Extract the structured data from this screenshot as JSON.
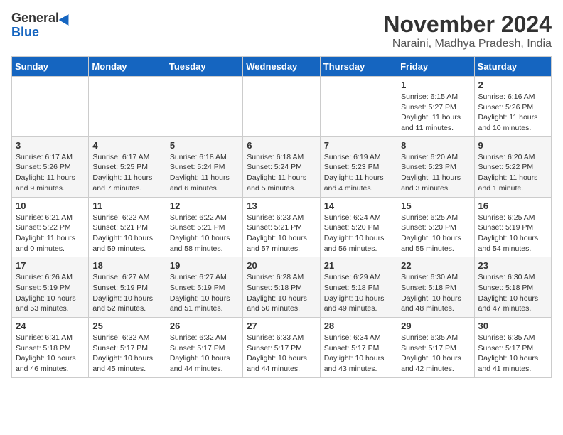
{
  "logo": {
    "line1": "General",
    "line2": "Blue"
  },
  "title": "November 2024",
  "subtitle": "Naraini, Madhya Pradesh, India",
  "days_of_week": [
    "Sunday",
    "Monday",
    "Tuesday",
    "Wednesday",
    "Thursday",
    "Friday",
    "Saturday"
  ],
  "weeks": [
    [
      {
        "day": "",
        "info": ""
      },
      {
        "day": "",
        "info": ""
      },
      {
        "day": "",
        "info": ""
      },
      {
        "day": "",
        "info": ""
      },
      {
        "day": "",
        "info": ""
      },
      {
        "day": "1",
        "info": "Sunrise: 6:15 AM\nSunset: 5:27 PM\nDaylight: 11 hours and 11 minutes."
      },
      {
        "day": "2",
        "info": "Sunrise: 6:16 AM\nSunset: 5:26 PM\nDaylight: 11 hours and 10 minutes."
      }
    ],
    [
      {
        "day": "3",
        "info": "Sunrise: 6:17 AM\nSunset: 5:26 PM\nDaylight: 11 hours and 9 minutes."
      },
      {
        "day": "4",
        "info": "Sunrise: 6:17 AM\nSunset: 5:25 PM\nDaylight: 11 hours and 7 minutes."
      },
      {
        "day": "5",
        "info": "Sunrise: 6:18 AM\nSunset: 5:24 PM\nDaylight: 11 hours and 6 minutes."
      },
      {
        "day": "6",
        "info": "Sunrise: 6:18 AM\nSunset: 5:24 PM\nDaylight: 11 hours and 5 minutes."
      },
      {
        "day": "7",
        "info": "Sunrise: 6:19 AM\nSunset: 5:23 PM\nDaylight: 11 hours and 4 minutes."
      },
      {
        "day": "8",
        "info": "Sunrise: 6:20 AM\nSunset: 5:23 PM\nDaylight: 11 hours and 3 minutes."
      },
      {
        "day": "9",
        "info": "Sunrise: 6:20 AM\nSunset: 5:22 PM\nDaylight: 11 hours and 1 minute."
      }
    ],
    [
      {
        "day": "10",
        "info": "Sunrise: 6:21 AM\nSunset: 5:22 PM\nDaylight: 11 hours and 0 minutes."
      },
      {
        "day": "11",
        "info": "Sunrise: 6:22 AM\nSunset: 5:21 PM\nDaylight: 10 hours and 59 minutes."
      },
      {
        "day": "12",
        "info": "Sunrise: 6:22 AM\nSunset: 5:21 PM\nDaylight: 10 hours and 58 minutes."
      },
      {
        "day": "13",
        "info": "Sunrise: 6:23 AM\nSunset: 5:21 PM\nDaylight: 10 hours and 57 minutes."
      },
      {
        "day": "14",
        "info": "Sunrise: 6:24 AM\nSunset: 5:20 PM\nDaylight: 10 hours and 56 minutes."
      },
      {
        "day": "15",
        "info": "Sunrise: 6:25 AM\nSunset: 5:20 PM\nDaylight: 10 hours and 55 minutes."
      },
      {
        "day": "16",
        "info": "Sunrise: 6:25 AM\nSunset: 5:19 PM\nDaylight: 10 hours and 54 minutes."
      }
    ],
    [
      {
        "day": "17",
        "info": "Sunrise: 6:26 AM\nSunset: 5:19 PM\nDaylight: 10 hours and 53 minutes."
      },
      {
        "day": "18",
        "info": "Sunrise: 6:27 AM\nSunset: 5:19 PM\nDaylight: 10 hours and 52 minutes."
      },
      {
        "day": "19",
        "info": "Sunrise: 6:27 AM\nSunset: 5:19 PM\nDaylight: 10 hours and 51 minutes."
      },
      {
        "day": "20",
        "info": "Sunrise: 6:28 AM\nSunset: 5:18 PM\nDaylight: 10 hours and 50 minutes."
      },
      {
        "day": "21",
        "info": "Sunrise: 6:29 AM\nSunset: 5:18 PM\nDaylight: 10 hours and 49 minutes."
      },
      {
        "day": "22",
        "info": "Sunrise: 6:30 AM\nSunset: 5:18 PM\nDaylight: 10 hours and 48 minutes."
      },
      {
        "day": "23",
        "info": "Sunrise: 6:30 AM\nSunset: 5:18 PM\nDaylight: 10 hours and 47 minutes."
      }
    ],
    [
      {
        "day": "24",
        "info": "Sunrise: 6:31 AM\nSunset: 5:18 PM\nDaylight: 10 hours and 46 minutes."
      },
      {
        "day": "25",
        "info": "Sunrise: 6:32 AM\nSunset: 5:17 PM\nDaylight: 10 hours and 45 minutes."
      },
      {
        "day": "26",
        "info": "Sunrise: 6:32 AM\nSunset: 5:17 PM\nDaylight: 10 hours and 44 minutes."
      },
      {
        "day": "27",
        "info": "Sunrise: 6:33 AM\nSunset: 5:17 PM\nDaylight: 10 hours and 44 minutes."
      },
      {
        "day": "28",
        "info": "Sunrise: 6:34 AM\nSunset: 5:17 PM\nDaylight: 10 hours and 43 minutes."
      },
      {
        "day": "29",
        "info": "Sunrise: 6:35 AM\nSunset: 5:17 PM\nDaylight: 10 hours and 42 minutes."
      },
      {
        "day": "30",
        "info": "Sunrise: 6:35 AM\nSunset: 5:17 PM\nDaylight: 10 hours and 41 minutes."
      }
    ]
  ]
}
